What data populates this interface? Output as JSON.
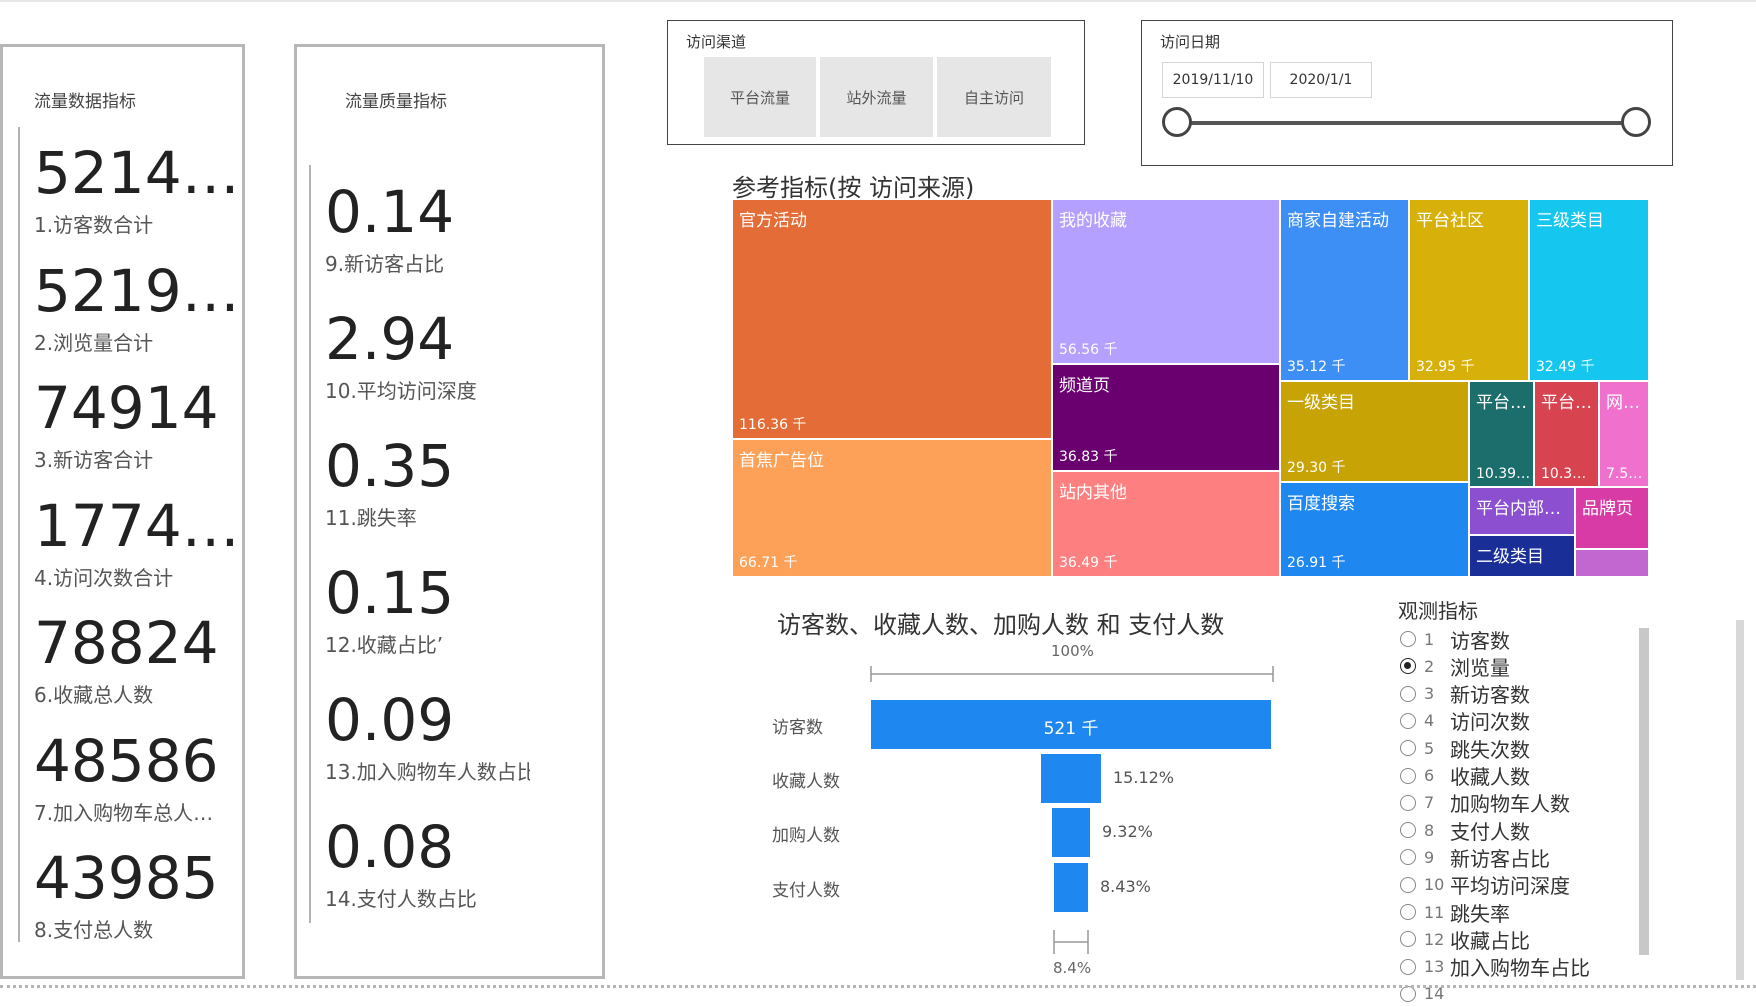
{
  "traffic_panel": {
    "title": "流量数据指标",
    "kpis": [
      {
        "value": "5214…",
        "label": "1.访客数合计"
      },
      {
        "value": "5219…",
        "label": "2.浏览量合计"
      },
      {
        "value": "74914",
        "label": "3.新访客合计"
      },
      {
        "value": "1774…",
        "label": "4.访问次数合计"
      },
      {
        "value": "78824",
        "label": "6.收藏总人数"
      },
      {
        "value": "48586",
        "label": "7.加入购物车总人…"
      },
      {
        "value": "43985",
        "label": "8.支付总人数"
      }
    ]
  },
  "quality_panel": {
    "title": "流量质量指标",
    "kpis": [
      {
        "value": "0.14",
        "label": "9.新访客占比"
      },
      {
        "value": "2.94",
        "label": "10.平均访问深度"
      },
      {
        "value": "0.35",
        "label": "11.跳失率"
      },
      {
        "value": "0.15",
        "label": "12.收藏占比’"
      },
      {
        "value": "0.09",
        "label": "13.加入购物车人数占比"
      },
      {
        "value": "0.08",
        "label": "14.支付人数占比"
      }
    ]
  },
  "channel_slicer": {
    "title": "访问渠道",
    "options": [
      "平台流量",
      "站外流量",
      "自主访问"
    ]
  },
  "date_slicer": {
    "title": "访问日期",
    "start": "2019/11/10",
    "end": "2020/1/1"
  },
  "treemap": {
    "title": "参考指标(按 访问来源)",
    "tiles": [
      {
        "label": "官方活动",
        "value": "116.36 千",
        "color": "#e46c36"
      },
      {
        "label": "首焦广告位",
        "value": "66.71 千",
        "color": "#fda159"
      },
      {
        "label": "我的收藏",
        "value": "56.56 千",
        "color": "#b3a0ff"
      },
      {
        "label": "频道页",
        "value": "36.83 千",
        "color": "#6a0070"
      },
      {
        "label": "站内其他",
        "value": "36.49 千",
        "color": "#fd7f80"
      },
      {
        "label": "商家自建活动",
        "value": "35.12 千",
        "color": "#3e8ff5"
      },
      {
        "label": "平台社区",
        "value": "32.95 千",
        "color": "#d8b00a"
      },
      {
        "label": "三级类目",
        "value": "32.49 千",
        "color": "#15c6ef"
      },
      {
        "label": "一级类目",
        "value": "29.30 千",
        "color": "#c7a305"
      },
      {
        "label": "平台…",
        "value": "10.39…",
        "color": "#1b6e6c"
      },
      {
        "label": "平台…",
        "value": "10.3…",
        "color": "#d7434f"
      },
      {
        "label": "网…",
        "value": "7.5…",
        "color": "#f071cd"
      },
      {
        "label": "百度搜索",
        "value": "26.91 千",
        "color": "#1e88f0"
      },
      {
        "label": "平台内部…",
        "value": "",
        "color": "#8b4fd0"
      },
      {
        "label": "品牌页",
        "value": "",
        "color": "#d83aa6"
      },
      {
        "label": "二级类目",
        "value": "",
        "color": "#1a2e98"
      },
      {
        "label": "",
        "value": "",
        "color": "#c266d0"
      }
    ]
  },
  "funnel": {
    "title": "访客数、收藏人数、加购人数 和 支付人数",
    "top_pct": "100%",
    "bottom_pct": "8.4%",
    "rows": [
      {
        "label": "访客数",
        "ratio": 1.0,
        "bar_text": "521 千",
        "pct": ""
      },
      {
        "label": "收藏人数",
        "ratio": 0.1512,
        "bar_text": "",
        "pct": "15.12%"
      },
      {
        "label": "加购人数",
        "ratio": 0.0932,
        "bar_text": "",
        "pct": "9.32%"
      },
      {
        "label": "支付人数",
        "ratio": 0.0843,
        "bar_text": "",
        "pct": "8.43%"
      }
    ],
    "bar_color": "#1e88f0"
  },
  "metric_selector": {
    "title": "观测指标",
    "selected_index": 1,
    "items": [
      {
        "num": "1",
        "label": "访客数"
      },
      {
        "num": "2",
        "label": "浏览量"
      },
      {
        "num": "3",
        "label": "新访客数"
      },
      {
        "num": "4",
        "label": "访问次数"
      },
      {
        "num": "5",
        "label": "跳失次数"
      },
      {
        "num": "6",
        "label": "收藏人数"
      },
      {
        "num": "7",
        "label": "加购物车人数"
      },
      {
        "num": "8",
        "label": "支付人数"
      },
      {
        "num": "9",
        "label": "新访客占比"
      },
      {
        "num": "10",
        "label": "平均访问深度"
      },
      {
        "num": "11",
        "label": "跳失率"
      },
      {
        "num": "12",
        "label": "收藏占比"
      },
      {
        "num": "13",
        "label": "加入购物车占比"
      },
      {
        "num": "14",
        "label": ""
      }
    ]
  }
}
